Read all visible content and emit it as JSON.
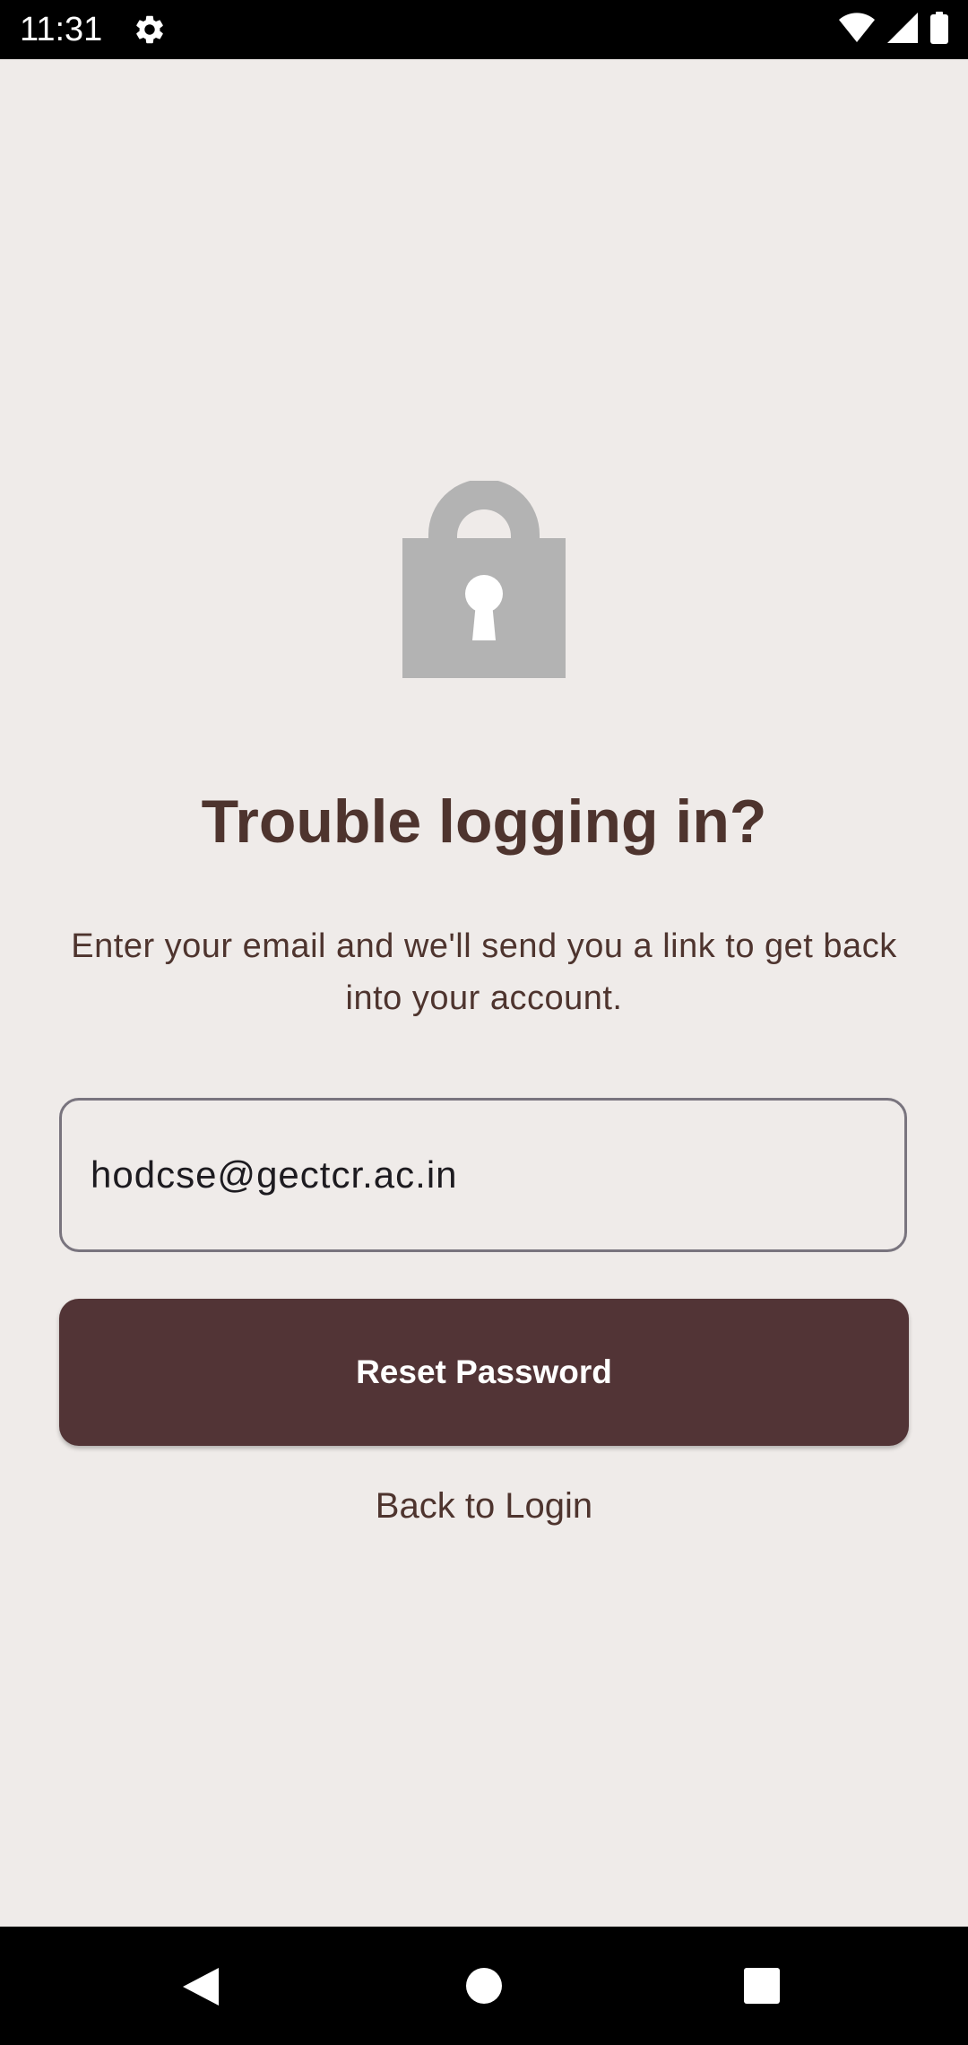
{
  "status_bar": {
    "time": "11:31",
    "icons": [
      "gear-icon",
      "wifi-icon",
      "signal-icon",
      "battery-icon"
    ]
  },
  "page": {
    "title": "Trouble logging in?",
    "subtitle": "Enter your email and we'll send you a link to get back into your account."
  },
  "form": {
    "email_value": "hodcse@gectcr.ac.in",
    "reset_label": "Reset Password",
    "back_label": "Back to Login"
  },
  "nav_bar": {
    "icons": [
      "back-icon",
      "home-icon",
      "recents-icon"
    ]
  },
  "colors": {
    "background": "#efebe9",
    "accent": "#523436",
    "text": "#4e342e",
    "lock_icon": "#b3b3b3"
  }
}
